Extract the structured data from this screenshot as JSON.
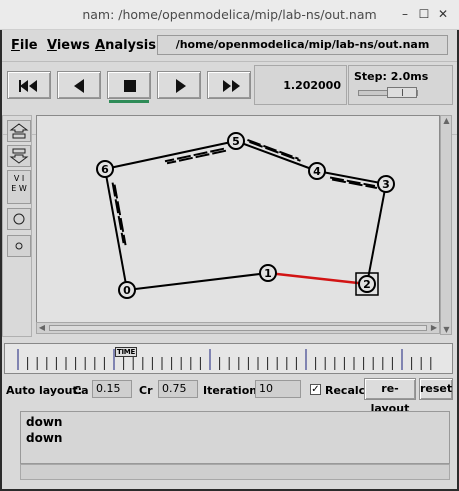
{
  "window": {
    "title": "nam: /home/openmodelica/mip/lab-ns/out.nam",
    "minimize_glyph": "–",
    "maximize_glyph": "☐",
    "close_glyph": "✕"
  },
  "menu": {
    "file_u": "F",
    "file_rest": "ile",
    "views_u": "V",
    "views_rest": "iews",
    "analysis_u": "A",
    "analysis_rest": "nalysis",
    "path": "/home/openmodelica/mip/lab-ns/out.nam"
  },
  "playback": {
    "buttons": [
      {
        "name": "rewind",
        "icon": "fast-rewind-icon"
      },
      {
        "name": "play-backward",
        "icon": "play-backward-icon"
      },
      {
        "name": "stop",
        "icon": "stop-icon",
        "active": true
      },
      {
        "name": "play-forward",
        "icon": "play-forward-icon"
      },
      {
        "name": "fast-forward",
        "icon": "fast-forward-icon"
      }
    ],
    "time": "1.202000",
    "step_label": "Step: 2.0ms",
    "active_color": "#2e8b57"
  },
  "tools": {
    "zoom_in_icon": "zoom-in-icon",
    "zoom_out_icon": "zoom-out-icon",
    "view_label_top": "V I",
    "view_label_bottom": "E W",
    "circle_large_icon": "circle-large-icon",
    "circle_small_icon": "circle-small-icon"
  },
  "topology": {
    "nodes": [
      {
        "id": "0"
      },
      {
        "id": "1"
      },
      {
        "id": "2"
      },
      {
        "id": "3"
      },
      {
        "id": "4"
      },
      {
        "id": "5"
      },
      {
        "id": "6"
      }
    ],
    "links": [
      {
        "from": "0",
        "to": "1",
        "color": "#000000"
      },
      {
        "from": "1",
        "to": "2",
        "color": "#d21414"
      },
      {
        "from": "2",
        "to": "3",
        "color": "#000000"
      },
      {
        "from": "3",
        "to": "4",
        "color": "#000000"
      },
      {
        "from": "4",
        "to": "5",
        "color": "#000000"
      },
      {
        "from": "5",
        "to": "6",
        "color": "#000000"
      },
      {
        "from": "6",
        "to": "0",
        "color": "#000000"
      }
    ],
    "highlighted_node": "2"
  },
  "timeline": {
    "label": "TIME"
  },
  "auto_layout": {
    "label": "Auto layout:",
    "ca_label": "Ca",
    "ca_value": "0.15",
    "cr_label": "Cr",
    "cr_value": "0.75",
    "iterations_label": "Iterations",
    "iterations_value": "10",
    "recalc_label": "Recalc",
    "recalc_checked": "✓",
    "relayout_label": "re-layout",
    "reset_label": "reset"
  },
  "log": {
    "lines": [
      "down",
      "down"
    ]
  }
}
